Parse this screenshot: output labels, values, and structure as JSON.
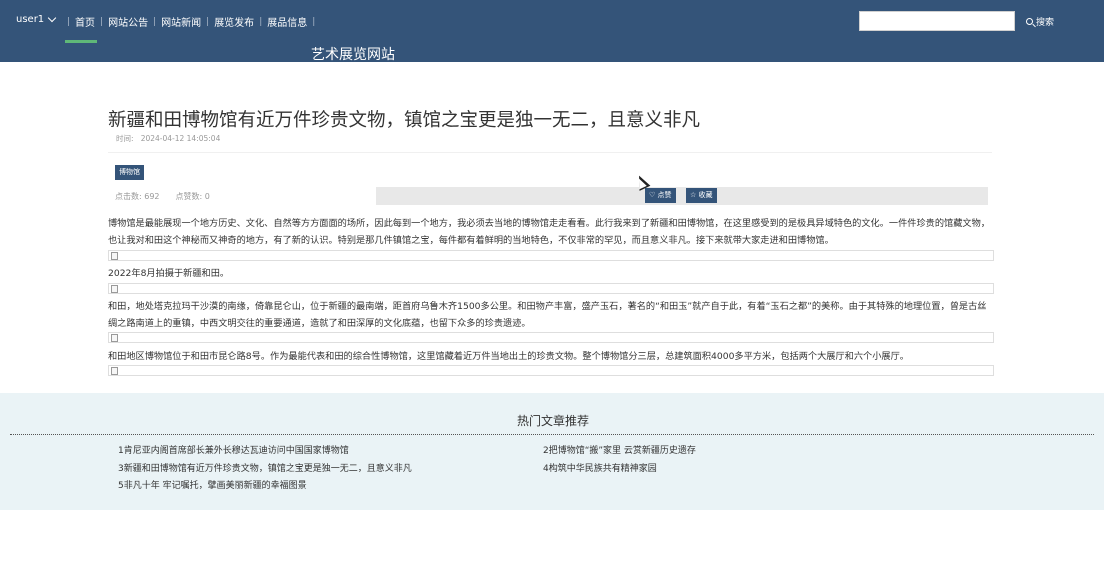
{
  "header": {
    "user": "user1",
    "nav": [
      "首页",
      "网站公告",
      "网站新闻",
      "展览发布",
      "展品信息"
    ],
    "search_placeholder": "",
    "search_label": "搜索",
    "site_title": "艺术展览网站"
  },
  "article": {
    "title": "新疆和田博物馆有近万件珍贵文物，镇馆之宝更是独一无二，且意义非凡",
    "time_label": "时间:",
    "time": "2024-04-12 14:05:04",
    "tag": "博物馆",
    "clicks_label": "点击数:",
    "clicks": "692",
    "likes_label": "点赞数:",
    "likes": "0",
    "like_button": "♡ 点赞",
    "fav_button": "☆ 收藏",
    "paragraphs": [
      "博物馆是最能展现一个地方历史、文化、自然等方方面面的场所，因此每到一个地方，我必须去当地的博物馆走走看看。此行我来到了新疆和田博物馆，在这里感受到的是极具异域特色的文化。一件件珍贵的馆藏文物，也让我对和田这个神秘而又神奇的地方，有了新的认识。特别是那几件镇馆之宝，每件都有着鲜明的当地特色，不仅非常的罕见，而且意义非凡。接下来就带大家走进和田博物馆。",
      "2022年8月拍摄于新疆和田。",
      "和田，地处塔克拉玛干沙漠的南缘，倚靠昆仑山，位于新疆的最南端，距首府乌鲁木齐1500多公里。和田物产丰富，盛产玉石，著名的“和田玉”就产自于此，有着“玉石之都”的美称。由于其特殊的地理位置，曾是古丝绸之路南道上的重镇，中西文明交往的重要通道，造就了和田深厚的文化底蕴，也留下众多的珍贵遗迹。",
      "和田地区博物馆位于和田市昆仑路8号。作为最能代表和田的综合性博物馆，这里馆藏着近万件当地出土的珍贵文物。整个博物馆分三层，总建筑面积4000多平方米，包括两个大展厅和六个小展厅。"
    ]
  },
  "footer": {
    "title": "热门文章推荐",
    "items": [
      "1肯尼亚内阁首席部长兼外长穆达瓦迪访问中国国家博物馆",
      "2把博物馆“搬”家里 云赏新疆历史遗存",
      "3新疆和田博物馆有近万件珍贵文物，镇馆之宝更是独一无二，且意义非凡",
      "4构筑中华民族共有精神家园",
      "5非凡十年 牢记嘱托，擘画美丽新疆的幸福图景"
    ]
  }
}
